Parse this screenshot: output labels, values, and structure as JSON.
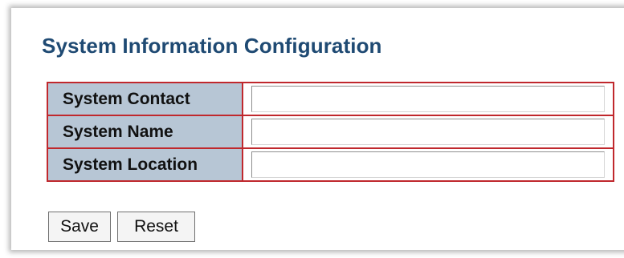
{
  "page": {
    "title": "System Information Configuration"
  },
  "form": {
    "rows": [
      {
        "label": "System Contact",
        "value": ""
      },
      {
        "label": "System Name",
        "value": ""
      },
      {
        "label": "System Location",
        "value": ""
      }
    ]
  },
  "buttons": {
    "save_label": "Save",
    "reset_label": "Reset"
  },
  "colors": {
    "title": "#1f4a73",
    "label_bg": "#b7c6d5",
    "border": "#c0282d"
  }
}
